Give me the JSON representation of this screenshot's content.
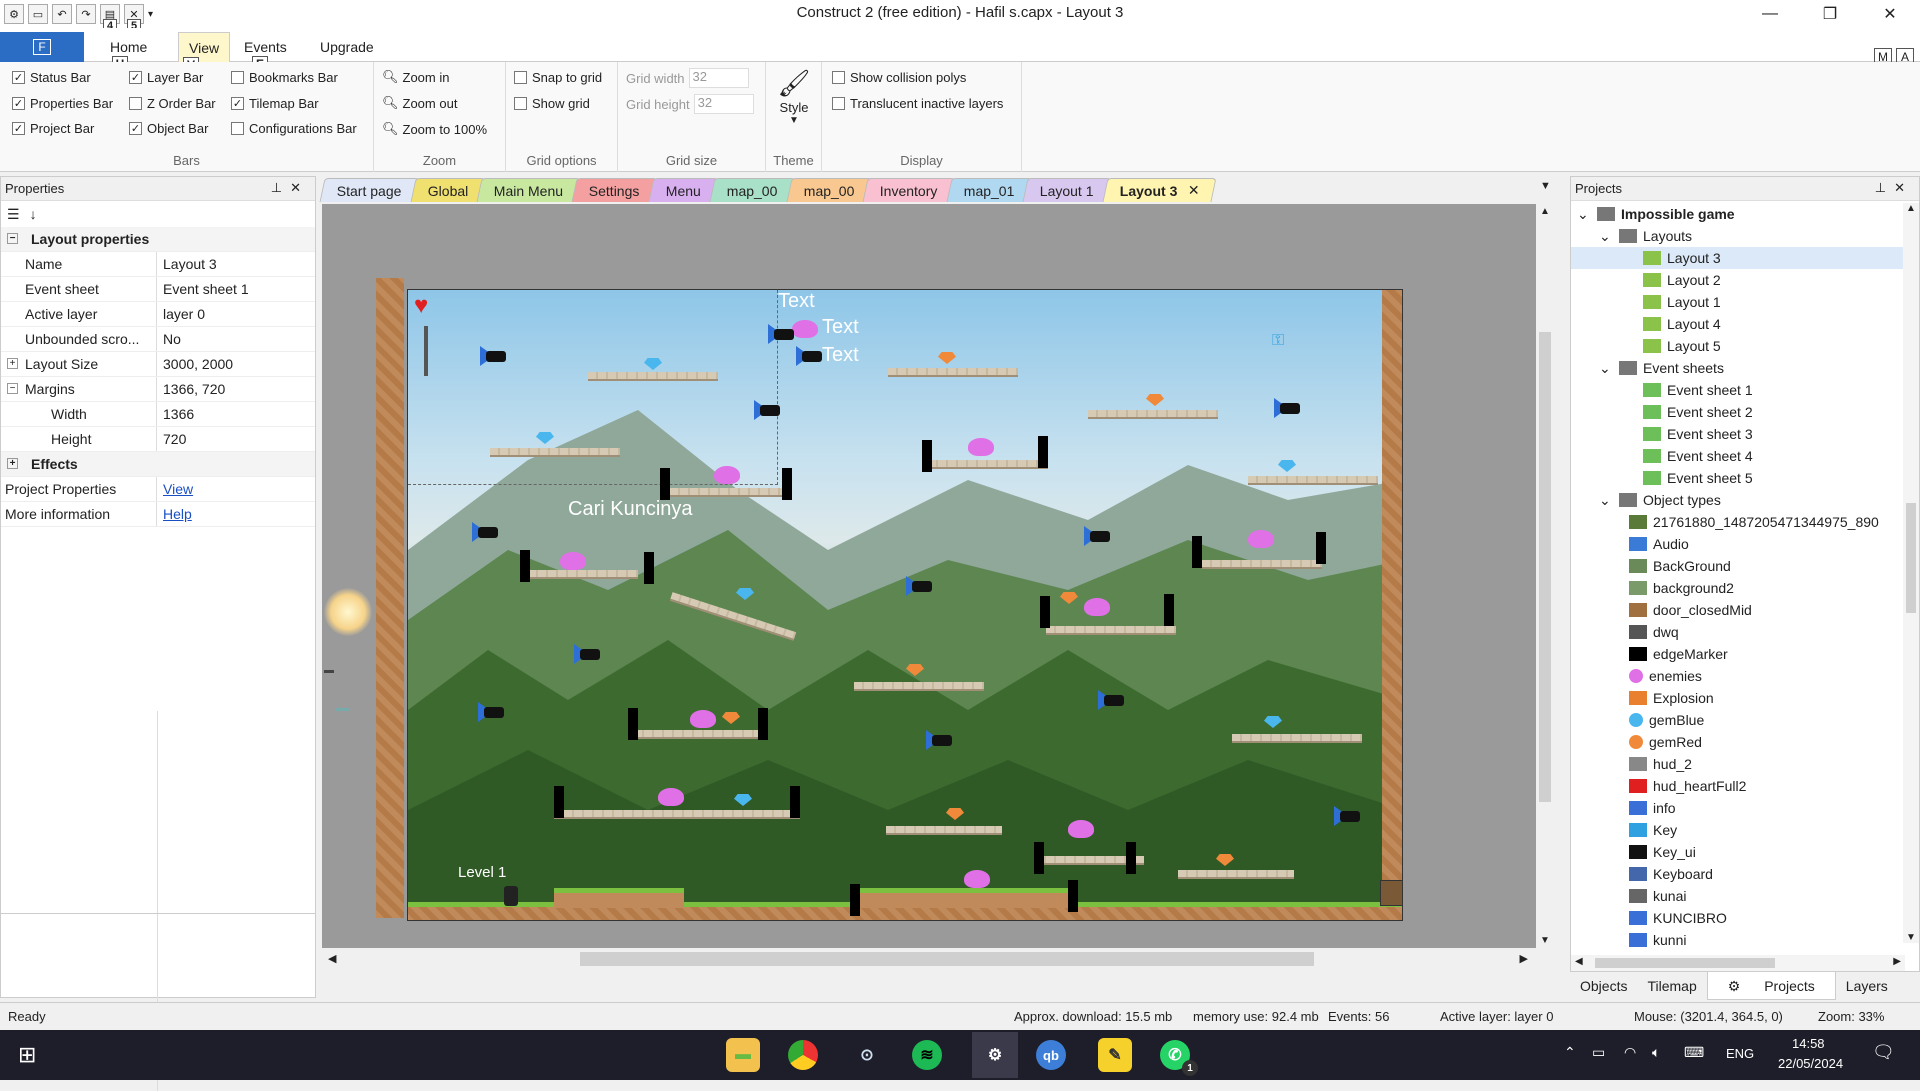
{
  "app": {
    "title": "Construct 2  (free edition) - Hafil s.capx - Layout 3"
  },
  "qat": {
    "keys": [
      "4",
      "5"
    ]
  },
  "ribbon": {
    "file_label": "F",
    "tabs": [
      {
        "label": "Home",
        "key": "H"
      },
      {
        "label": "View",
        "key": "V"
      },
      {
        "label": "Events",
        "key": "E"
      },
      {
        "label": "Upgrade",
        "key": ""
      }
    ],
    "right_keys": [
      "M",
      "A"
    ],
    "bars": {
      "items": [
        {
          "label": "Status Bar",
          "checked": true
        },
        {
          "label": "Properties Bar",
          "checked": true
        },
        {
          "label": "Project Bar",
          "checked": true
        },
        {
          "label": "Layer Bar",
          "checked": true
        },
        {
          "label": "Z Order Bar",
          "checked": false
        },
        {
          "label": "Object Bar",
          "checked": true
        },
        {
          "label": "Bookmarks Bar",
          "checked": false
        },
        {
          "label": "Tilemap Bar",
          "checked": true
        },
        {
          "label": "Configurations Bar",
          "checked": false
        }
      ],
      "label": "Bars"
    },
    "zoom": {
      "items": [
        "Zoom in",
        "Zoom out",
        "Zoom to 100%"
      ],
      "label": "Zoom"
    },
    "grid_options": {
      "items": [
        {
          "label": "Snap to grid",
          "checked": false
        },
        {
          "label": "Show grid",
          "checked": false
        }
      ],
      "label": "Grid options"
    },
    "grid_size": {
      "width_label": "Grid width",
      "width": "32",
      "height_label": "Grid height",
      "height": "32",
      "label": "Grid size"
    },
    "theme": {
      "style_label": "Style",
      "label": "Theme"
    },
    "display": {
      "items": [
        {
          "label": "Show collision polys",
          "checked": false
        },
        {
          "label": "Translucent inactive layers",
          "checked": false
        }
      ],
      "label": "Display"
    }
  },
  "properties": {
    "title": "Properties",
    "section": "Layout properties",
    "rows": [
      {
        "k": "Name",
        "v": "Layout 3"
      },
      {
        "k": "Event sheet",
        "v": "Event sheet 1"
      },
      {
        "k": "Active layer",
        "v": "layer 0"
      },
      {
        "k": "Unbounded scro...",
        "v": "No"
      },
      {
        "k": "Layout Size",
        "v": "3000, 2000"
      },
      {
        "k": "Margins",
        "v": "1366, 720"
      },
      {
        "k": "Width",
        "v": "1366"
      },
      {
        "k": "Height",
        "v": "720"
      }
    ],
    "effects": "Effects",
    "project_properties": {
      "k": "Project Properties",
      "v": "View"
    },
    "more_info": {
      "k": "More information",
      "v": "Help"
    }
  },
  "doc_tabs": [
    {
      "label": "Start page",
      "color": "#e0e8f8"
    },
    {
      "label": "Global",
      "color": "#f0e070"
    },
    {
      "label": "Main Menu",
      "color": "#c8e8a0"
    },
    {
      "label": "Settings",
      "color": "#f4a0a0"
    },
    {
      "label": "Menu",
      "color": "#d8b0f0"
    },
    {
      "label": "map_00",
      "color": "#a8e0c8"
    },
    {
      "label": "map_00",
      "color": "#f8c890"
    },
    {
      "label": "Inventory",
      "color": "#f8c0d0"
    },
    {
      "label": "map_01",
      "color": "#b0d8f0"
    },
    {
      "label": "Layout 1",
      "color": "#d8c8f0"
    },
    {
      "label": "Layout 3",
      "color": "#fff5b0"
    }
  ],
  "scene": {
    "text_objects": [
      "Text",
      "Text",
      "Text"
    ],
    "hint": "Cari Kuncinya",
    "level": "Level 1"
  },
  "projects": {
    "title": "Projects",
    "root": "Impossible game",
    "layouts_label": "Layouts",
    "layouts": [
      "Layout 3",
      "Layout 2",
      "Layout 1",
      "Layout 4",
      "Layout 5"
    ],
    "events_label": "Event sheets",
    "events": [
      "Event sheet 1",
      "Event sheet 2",
      "Event sheet 3",
      "Event sheet 4",
      "Event sheet 5"
    ],
    "objects_label": "Object types",
    "objects": [
      "21761880_1487205471344975_890",
      "Audio",
      "BackGround",
      "background2",
      "door_closedMid",
      "dwq",
      "edgeMarker",
      "enemies",
      "Explosion",
      "gemBlue",
      "gemRed",
      "hud_2",
      "hud_heartFull2",
      "info",
      "Key",
      "Key_ui",
      "Keyboard",
      "kunai",
      "KUNCIBRO",
      "kunni"
    ],
    "tabs": [
      "Objects",
      "Tilemap",
      "Projects",
      "Layers"
    ]
  },
  "status": {
    "ready": "Ready",
    "download": "Approx. download: 15.5 mb",
    "memory": "memory use: 92.4 mb",
    "events": "Events: 56",
    "active_layer": "Active layer: layer 0",
    "mouse": "Mouse: (3201.4, 364.5, 0)",
    "zoom": "Zoom: 33%"
  },
  "taskbar": {
    "lang": "ENG",
    "time": "14:58",
    "date": "22/05/2024",
    "badge": "1"
  }
}
